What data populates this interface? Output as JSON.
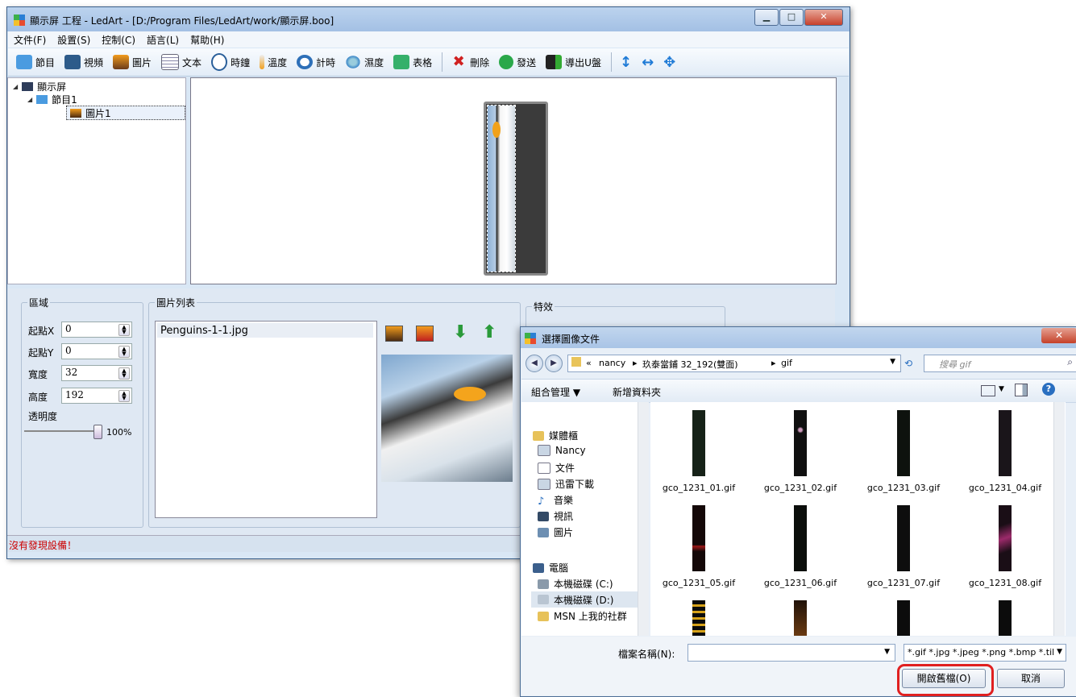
{
  "main_window": {
    "title": "顯示屏 工程 - LedArt - [D:/Program Files/LedArt/work/顯示屏.boo]",
    "controls": {
      "minimize": "▁",
      "maximize": "□",
      "close": "✕"
    },
    "menu": [
      "文件(F)",
      "設置(S)",
      "控制(C)",
      "語言(L)",
      "幫助(H)"
    ],
    "toolbar": [
      {
        "label": "節目",
        "icon": "program-icon"
      },
      {
        "label": "視頻",
        "icon": "video-icon"
      },
      {
        "label": "圖片",
        "icon": "picture-icon"
      },
      {
        "label": "文本",
        "icon": "text-icon"
      },
      {
        "label": "時鐘",
        "icon": "clock-icon"
      },
      {
        "label": "溫度",
        "icon": "thermometer-icon"
      },
      {
        "label": "計時",
        "icon": "alarm-icon"
      },
      {
        "label": "濕度",
        "icon": "humidity-icon"
      },
      {
        "label": "表格",
        "icon": "table-icon"
      },
      {
        "label": "刪除",
        "icon": "delete-icon"
      },
      {
        "label": "發送",
        "icon": "send-icon"
      },
      {
        "label": "導出U盤",
        "icon": "usb-export-icon"
      }
    ],
    "toolbar_arrows": [
      "↕",
      "↔",
      "✥"
    ],
    "tree": {
      "root": "顯示屏",
      "program": "節目1",
      "picture": "圖片1"
    },
    "region": {
      "group_label": "區域",
      "x_label": "起點X",
      "x_value": "0",
      "y_label": "起點Y",
      "y_value": "0",
      "w_label": "寬度",
      "w_value": "32",
      "h_label": "高度",
      "h_value": "192",
      "opacity_label": "透明度",
      "opacity_value": "100%",
      "opacity_level": 1.0
    },
    "image_list": {
      "group_label": "圖片列表",
      "items": [
        "Penguins-1-1.jpg"
      ]
    },
    "effects": {
      "group_label": "特效"
    },
    "status": "沒有發現設備！"
  },
  "dialog": {
    "title": "選擇圖像文件",
    "breadcrumb": [
      "«",
      "nancy",
      "玖泰當鋪 32_192(雙面)",
      "gif"
    ],
    "search_placeholder": "搜尋 gif",
    "organize": "組合管理 ▼",
    "new_folder": "新增資料夾",
    "nav": {
      "libraries": "媒體櫃",
      "items": [
        "Nancy",
        "文件",
        "迅雷下載",
        "音樂",
        "視訊",
        "圖片"
      ],
      "computer": "電腦",
      "drives": [
        "本機磁碟 (C:)",
        "本機磁碟 (D:)",
        "MSN 上我的社群"
      ]
    },
    "files": [
      "gco_1231_01.gif",
      "gco_1231_02.gif",
      "gco_1231_03.gif",
      "gco_1231_04.gif",
      "gco_1231_05.gif",
      "gco_1231_06.gif",
      "gco_1231_07.gif",
      "gco_1231_08.gif"
    ],
    "filename_label": "檔案名稱(N):",
    "filename_value": "",
    "filter": "*.gif *.jpg *.jpeg *.png *.bmp *.til",
    "open_label": "開啟舊檔(O)",
    "cancel_label": "取消"
  },
  "colors": {
    "status_text": "#cc0000",
    "highlight": "#e02020",
    "title_bar": "#a9c4e6"
  }
}
